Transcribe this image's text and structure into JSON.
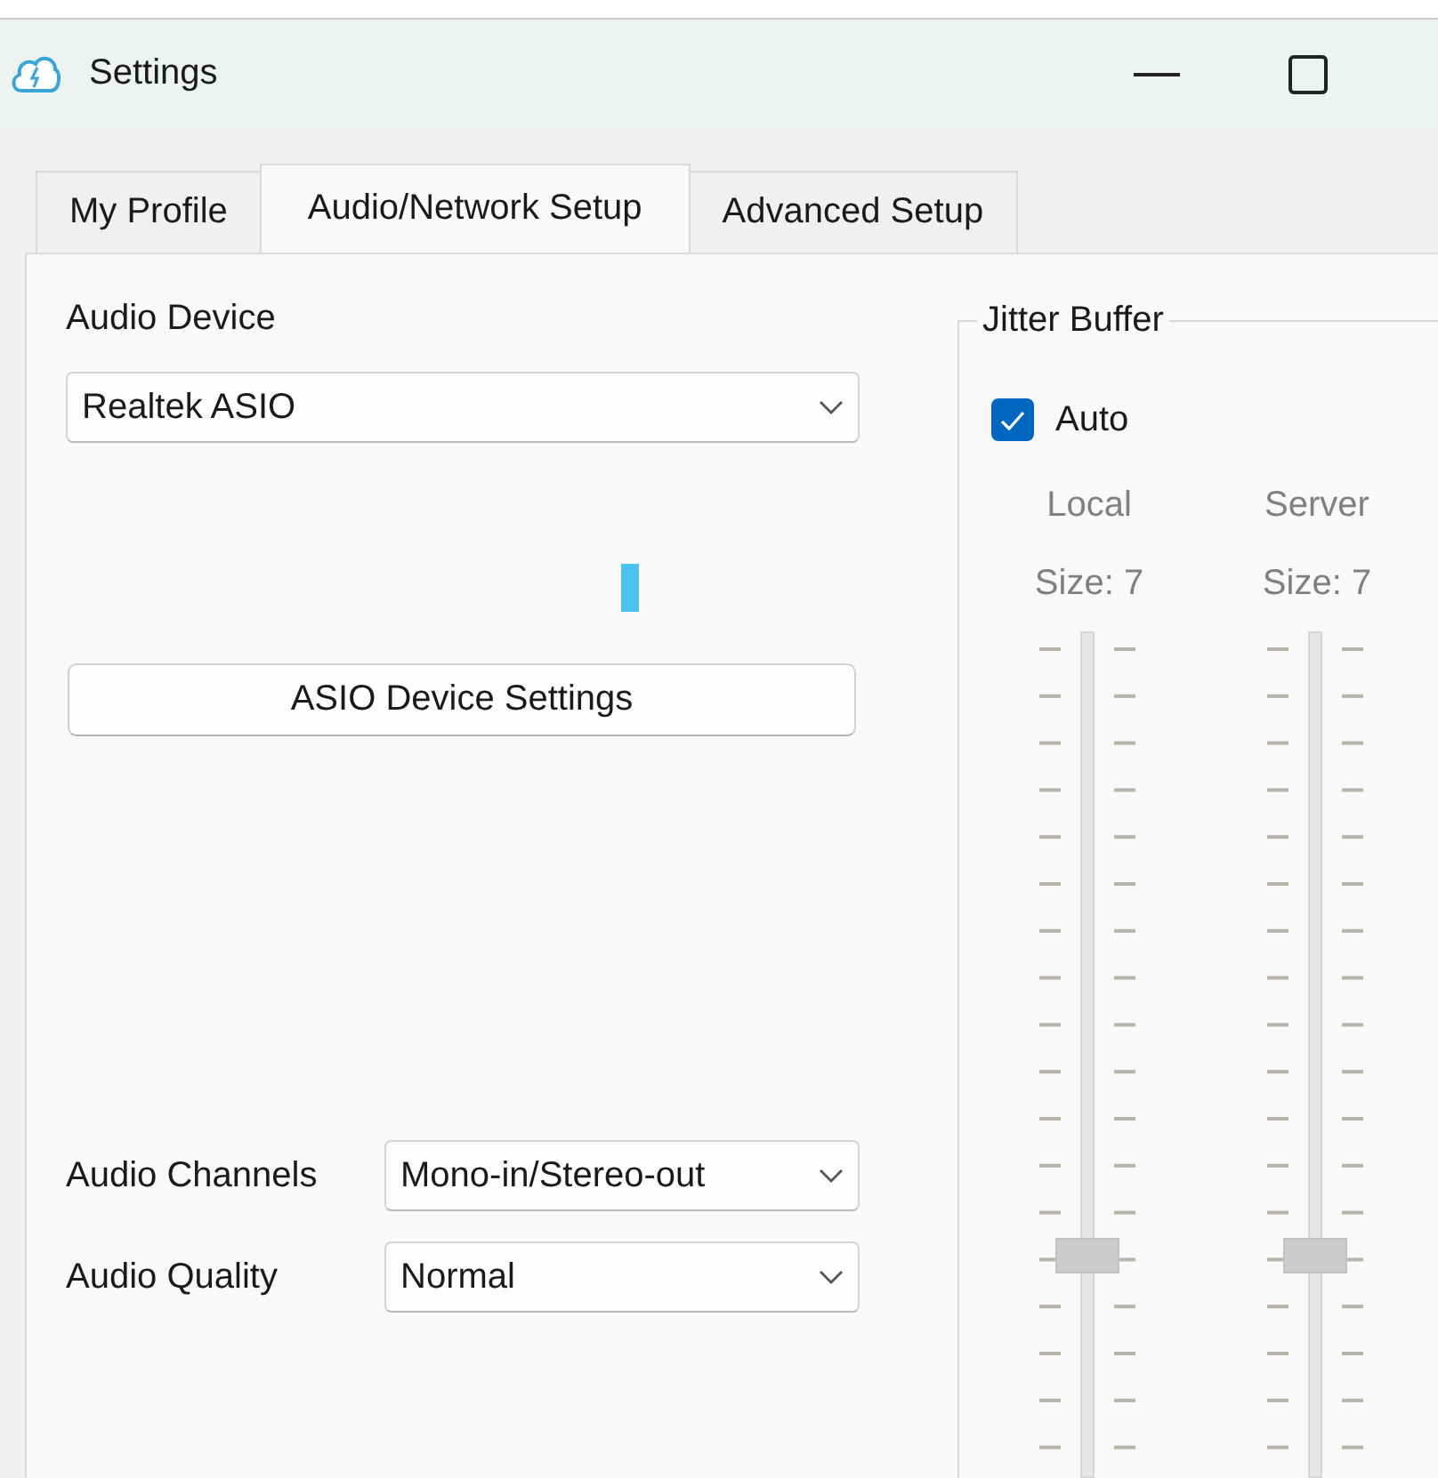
{
  "window": {
    "title": "Settings"
  },
  "tabs": [
    {
      "label": "My Profile",
      "selected": false
    },
    {
      "label": "Audio/Network Setup",
      "selected": true
    },
    {
      "label": "Advanced Setup",
      "selected": false
    }
  ],
  "audio_device": {
    "label": "Audio Device",
    "value": "Realtek ASIO"
  },
  "asio_button": "ASIO Device Settings",
  "audio_channels": {
    "label": "Audio Channels",
    "value": "Mono-in/Stereo-out"
  },
  "audio_quality": {
    "label": "Audio Quality",
    "value": "Normal"
  },
  "jitter_buffer": {
    "title": "Jitter Buffer",
    "auto": {
      "label": "Auto",
      "checked": true
    },
    "sliders": [
      {
        "label": "Local",
        "size": "Size: 7",
        "level": 0.26
      },
      {
        "label": "Server",
        "size": "Size: 7",
        "level": 0.26
      }
    ]
  }
}
